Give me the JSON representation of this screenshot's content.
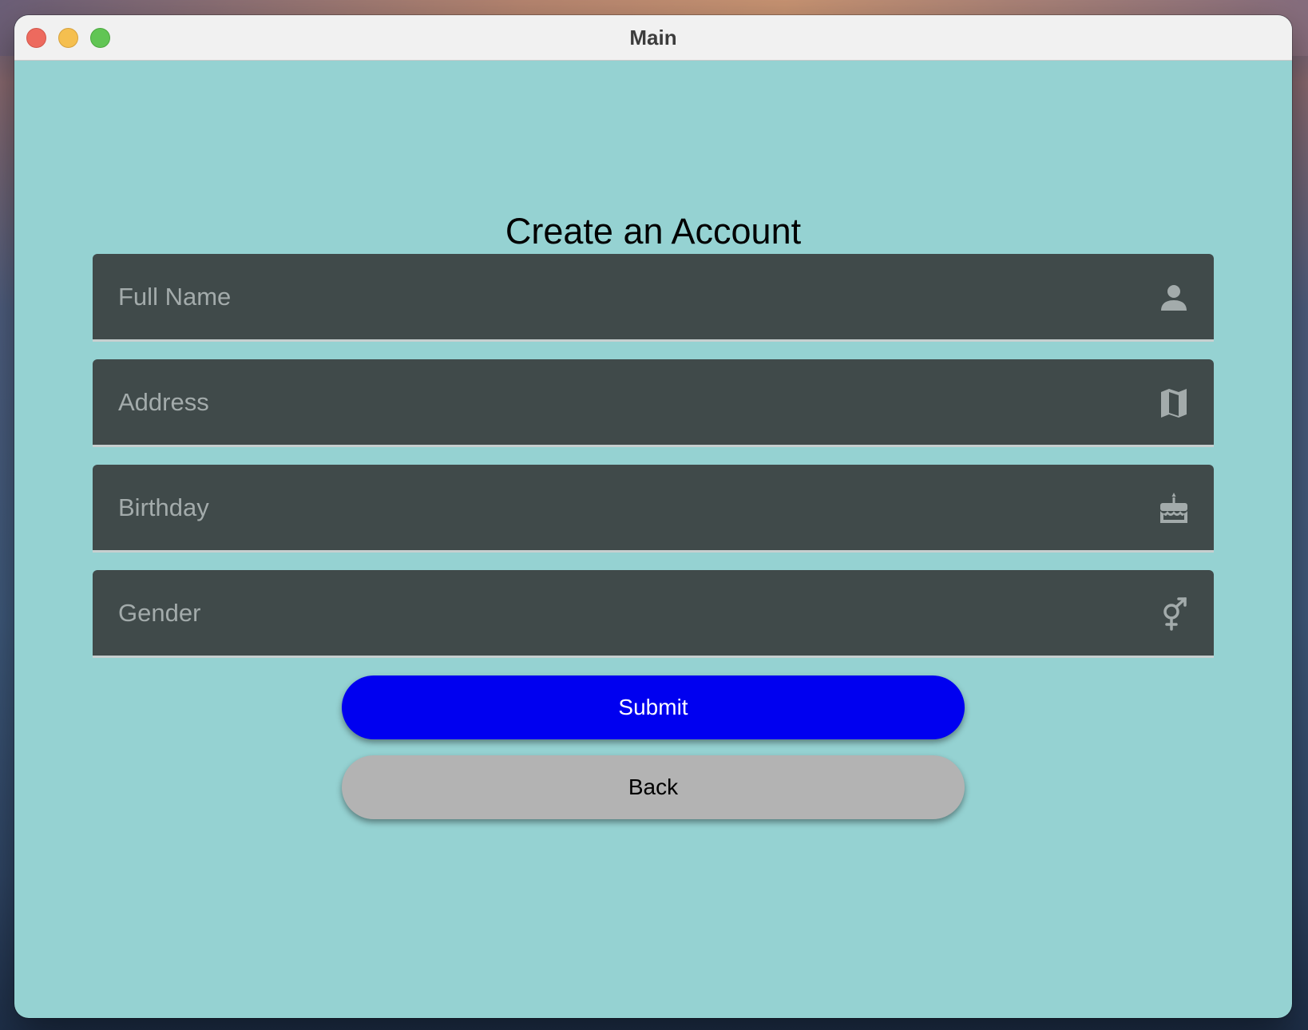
{
  "window": {
    "title": "Main"
  },
  "form": {
    "heading": "Create an Account",
    "fields": [
      {
        "placeholder": "Full Name",
        "value": "",
        "icon": "person-icon"
      },
      {
        "placeholder": "Address",
        "value": "",
        "icon": "map-icon"
      },
      {
        "placeholder": "Birthday",
        "value": "",
        "icon": "cake-icon"
      },
      {
        "placeholder": "Gender",
        "value": "",
        "icon": "gender-icon"
      }
    ],
    "submit_label": "Submit",
    "back_label": "Back"
  },
  "colors": {
    "background": "#95d2d2",
    "field_background": "#404a4a",
    "placeholder_text": "#a3abab",
    "submit_button": "#0000f0",
    "back_button": "#b3b3b3"
  }
}
